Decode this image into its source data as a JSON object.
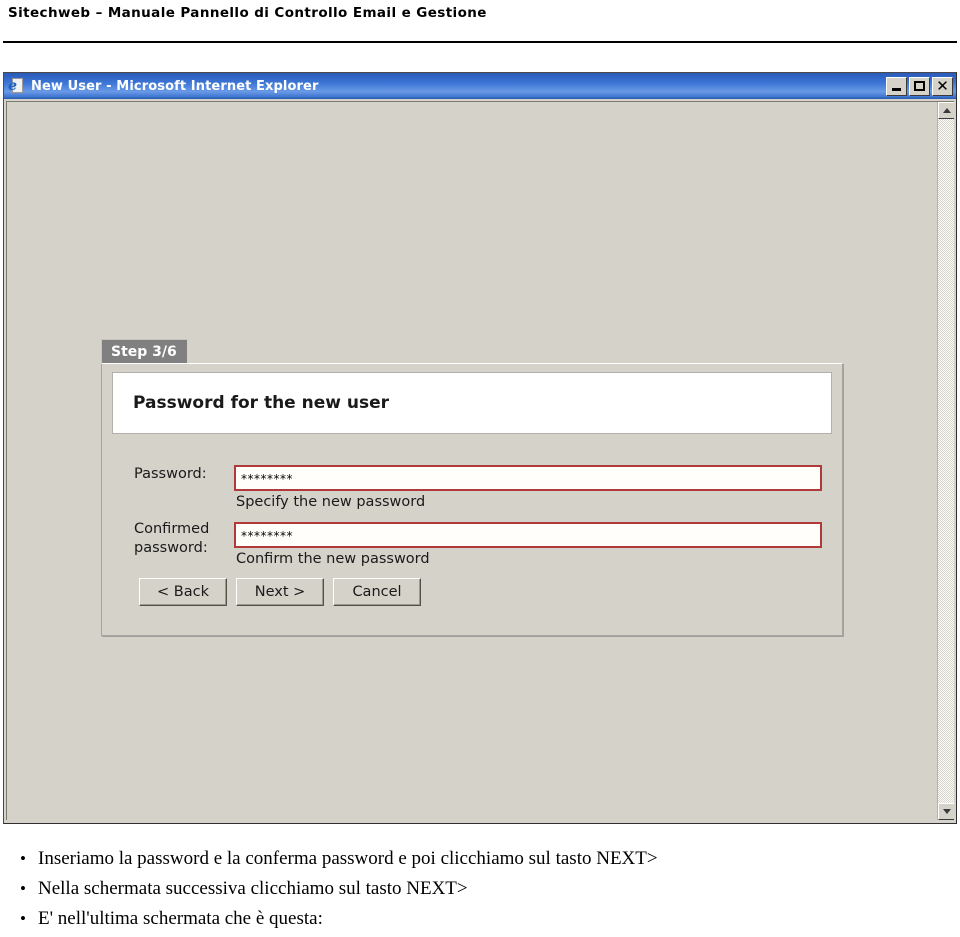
{
  "document": {
    "header_title": "Sitechweb – Manuale Pannello di Controllo Email e Gestione"
  },
  "browser_window": {
    "title": "New User - Microsoft Internet Explorer",
    "icon": "internet-explorer-icon",
    "controls": {
      "minimize_label": "_",
      "maximize_label": "□",
      "close_label": "✕"
    },
    "scrollbar": {
      "up_arrow": "▲",
      "down_arrow": "▼"
    }
  },
  "wizard": {
    "step_label": "Step 3/6",
    "heading": "Password for the new user",
    "fields": [
      {
        "label": "Password:",
        "value": "********",
        "hint": "Specify the new password"
      },
      {
        "label": "Confirmed password:",
        "value": "********",
        "hint": "Confirm the new password"
      }
    ],
    "buttons": {
      "back": "< Back",
      "next": "Next >",
      "cancel": "Cancel"
    },
    "colors": {
      "field_border": "#b03a3a",
      "step_tab_bg": "#808080",
      "dialog_bg": "#d5d2ca",
      "titlebar_blue": "#3f78d8"
    }
  },
  "instructions": {
    "bullet_marker": "•",
    "items": [
      "Inseriamo la password e la conferma password e poi clicchiamo sul tasto NEXT>",
      "Nella schermata successiva clicchiamo sul tasto NEXT>",
      "E' nell'ultima schermata che è questa:"
    ]
  }
}
